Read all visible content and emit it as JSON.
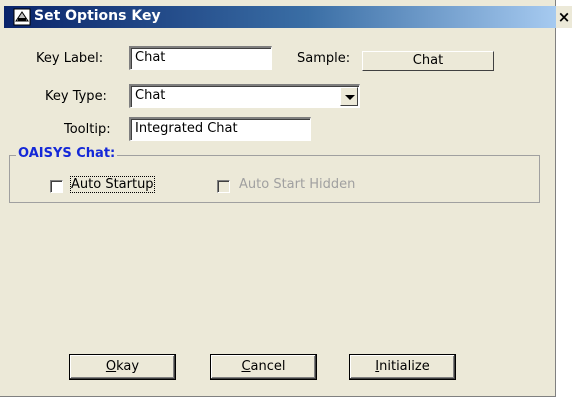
{
  "window": {
    "title": "Set Options Key",
    "close_glyph": "×",
    "icon": "keyboard-icon"
  },
  "form": {
    "key_label": {
      "label": "Key Label:",
      "value": "Chat"
    },
    "sample": {
      "label": "Sample:",
      "button_text": "Chat"
    },
    "key_type": {
      "label": "Key Type:",
      "value": "Chat"
    },
    "tooltip": {
      "label": "Tooltip:",
      "value": "Integrated Chat"
    }
  },
  "group": {
    "title": "OAISYS Chat:",
    "title_color": "#1428d8",
    "auto_startup": {
      "label": "Auto Startup",
      "checked": false
    },
    "auto_start_hidden": {
      "label": "Auto Start Hidden",
      "checked": false,
      "enabled": false
    }
  },
  "buttons": {
    "okay": "Okay",
    "cancel": "Cancel",
    "initialize": "Initialize"
  },
  "colors": {
    "face": "#ece9d8",
    "title_start": "#0a246a",
    "title_end": "#a6caf0"
  }
}
